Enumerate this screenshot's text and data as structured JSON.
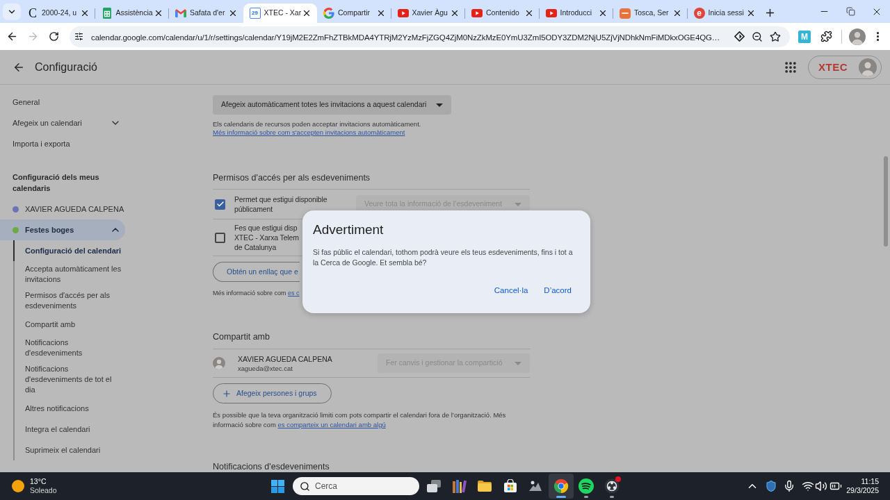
{
  "browser": {
    "tabs": [
      {
        "kind": "letter",
        "icon_text": "C",
        "title": "2000-24, u",
        "selected": false
      },
      {
        "kind": "sheets",
        "title": "Assistència",
        "selected": false
      },
      {
        "kind": "gmail",
        "title": "Safata d'er",
        "selected": false
      },
      {
        "kind": "calendar",
        "icon_text": "29",
        "title": "XTEC - Xar",
        "selected": true
      },
      {
        "kind": "google",
        "title": "Compartir",
        "selected": false
      },
      {
        "kind": "youtube",
        "title": "Xavier Àgu",
        "selected": false
      },
      {
        "kind": "youtube",
        "title": "Contenido",
        "selected": false
      },
      {
        "kind": "youtube",
        "title": "Introducci",
        "selected": false
      },
      {
        "kind": "tosca",
        "title": "Tosca, Ser",
        "selected": false
      },
      {
        "kind": "letter-circle",
        "icon_text": "e",
        "title": "Inicia sessi",
        "selected": false
      }
    ],
    "toolbar": {
      "forward_disabled": true,
      "url": "calendar.google.com/calendar/u/1/r/settings/calendar/Y19jM2E2ZmFhZTBkMDA4YTRjM2YzMzFjZGQ4ZjM0NzZkMzE0YmU3ZmI5ODY3ZDM2NjU5ZjVjNDhkNmFiMDkxOGE4QG…",
      "extension_text": "M"
    }
  },
  "header": {
    "title": "Configuració",
    "account_logo": "XTEC"
  },
  "sidebar": {
    "items": [
      {
        "kind": "link",
        "label": "General"
      },
      {
        "kind": "menu",
        "label": "Afegeix un calendari",
        "expanded": false
      },
      {
        "kind": "link",
        "label": "Importa i exporta"
      }
    ],
    "section_title": "Configuració dels meus calendaris",
    "calendars": [
      {
        "name": "XAVIER AGUEDA CALPENA",
        "color": "#6e73b4",
        "selected": false,
        "expanded": false
      },
      {
        "name": "Festes boges",
        "color": "#6fa848",
        "selected": true,
        "expanded": true,
        "children": [
          {
            "label": "Configuració del calendari",
            "selected": true
          },
          {
            "label": "Accepta automàticament les invitacions",
            "selected": false
          },
          {
            "label": "Permisos d'accés per als esdeveniments",
            "selected": false
          },
          {
            "label": "Compartit amb",
            "selected": false
          },
          {
            "label": "Notificacions d'esdeveniments",
            "selected": false
          },
          {
            "label": "Notificacions d'esdeveniments de tot el dia",
            "selected": false
          },
          {
            "label": "Altres notificacions",
            "selected": false
          },
          {
            "label": "Integra el calendari",
            "selected": false
          },
          {
            "label": "Suprimeix el calendari",
            "selected": false
          }
        ]
      }
    ]
  },
  "content": {
    "auto_accept": {
      "dropdown": {
        "value": "Afegeix automàticament totes les invitacions a aquest calendari",
        "disabled": false
      },
      "help": "Els calendaris de recursos poden acceptar invitacions automàticament.",
      "help_link": "Més informació sobre com s'accepten invitacions automàticament"
    },
    "access": {
      "title": "Permisos d'accés per als esdeveniments",
      "options": [
        {
          "lines": [
            "Permet que estigui disponible",
            "públicament"
          ],
          "checked": true,
          "dropdown": {
            "value": "Veure tota la informació de l’esdeveniment",
            "disabled": true
          }
        },
        {
          "lines": [
            "Fes que estigui disp",
            "XTEC - Xarxa Telem",
            "de Catalunya"
          ],
          "checked": false
        }
      ],
      "link_button": "Obtén un enllaç que e",
      "help": "Més informació sobre com",
      "help_link": "es c"
    },
    "shared": {
      "title": "Compartit amb",
      "people": [
        {
          "name": "XAVIER AGUEDA CALPENA",
          "email": "xagueda@xtec.cat",
          "permission": {
            "value": "Fer canvis i gestionar la compartició",
            "disabled": true
          }
        }
      ],
      "add_button": "Afegeix persones i grups",
      "help": "És possible que la teva organització limiti com pots compartir el calendari fora de l’organització. Més informació sobre com",
      "help_link": "es comparteix un calendari amb algú"
    },
    "next_section": {
      "title": "Notificacions d'esdeveniments"
    }
  },
  "dialog": {
    "title": "Advertiment",
    "body": "Si fas públic el calendari, tothom podrà veure els teus esdeveniments, fins i tot a la Cerca de Google. Et sembla bé?",
    "buttons": [
      "Cancel·la",
      "D’acord"
    ]
  },
  "taskbar": {
    "weather": {
      "temperature": "13°C",
      "condition": "Soleado"
    },
    "search": {
      "placeholder": "Cerca"
    },
    "apps": [
      {
        "kind": "task-view",
        "selected": false,
        "running": false,
        "badge": false
      },
      {
        "kind": "books",
        "selected": false,
        "running": false,
        "badge": false
      },
      {
        "kind": "folder",
        "selected": false,
        "running": false,
        "badge": false
      },
      {
        "kind": "store",
        "selected": false,
        "running": false,
        "badge": false
      },
      {
        "kind": "figure",
        "selected": false,
        "running": false,
        "badge": false
      },
      {
        "kind": "chrome",
        "selected": true,
        "running": true,
        "badge": false
      },
      {
        "kind": "spotify",
        "selected": false,
        "running": true,
        "badge": false
      },
      {
        "kind": "ring",
        "selected": false,
        "running": true,
        "badge": true
      }
    ],
    "clock": {
      "time": "11:15",
      "date": "29/3/2025"
    }
  }
}
